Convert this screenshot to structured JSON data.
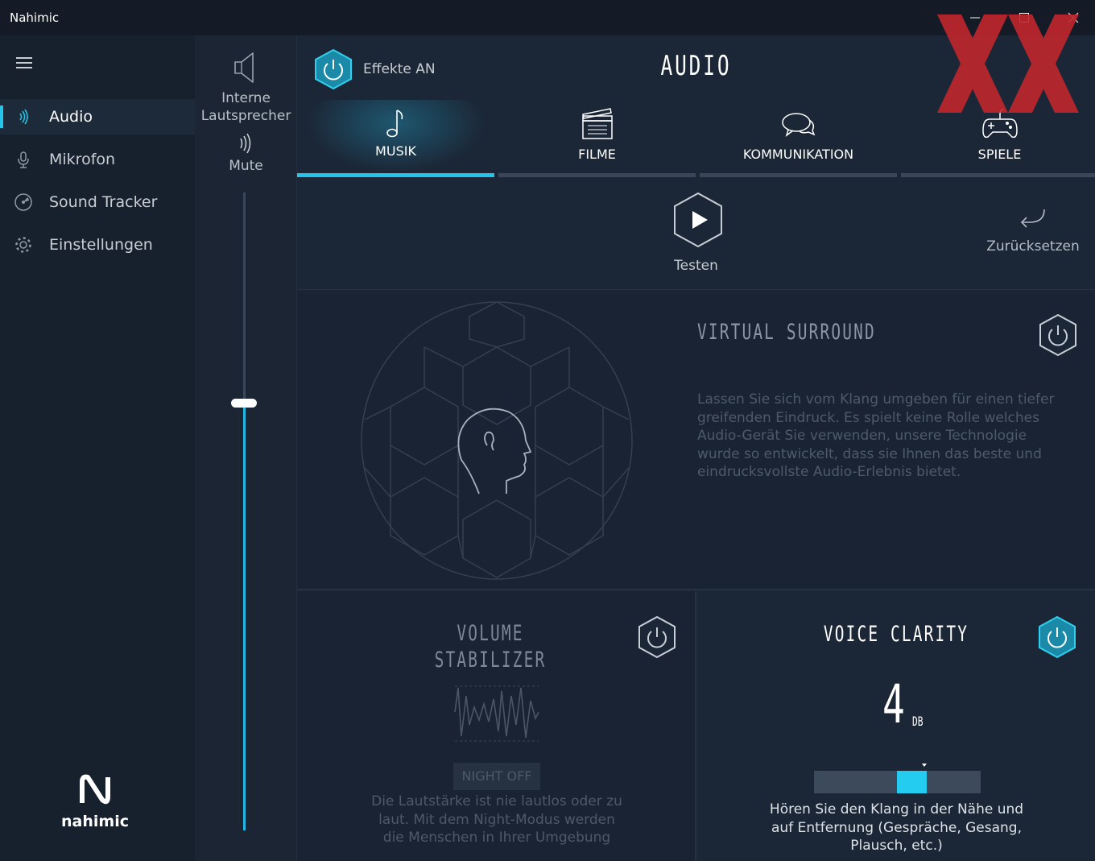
{
  "window": {
    "title": "Nahimic"
  },
  "sidebar": {
    "items": [
      {
        "label": "Audio",
        "icon": "audio-wave-icon",
        "active": true
      },
      {
        "label": "Mikrofon",
        "icon": "microphone-icon",
        "active": false
      },
      {
        "label": "Sound Tracker",
        "icon": "radar-icon",
        "active": false
      },
      {
        "label": "Einstellungen",
        "icon": "gear-icon",
        "active": false
      }
    ],
    "logo_text": "nahimic"
  },
  "device": {
    "name": "Interne Lautsprecher",
    "mute_label": "Mute",
    "volume_fraction": 0.64
  },
  "header": {
    "effects_label": "Effekte AN",
    "title": "AUDIO",
    "tabs": [
      {
        "label": "MUSIK",
        "icon": "music-note-icon",
        "active": true
      },
      {
        "label": "FILME",
        "icon": "clapperboard-icon",
        "active": false
      },
      {
        "label": "KOMMUNIKATION",
        "icon": "chat-bubbles-icon",
        "active": false
      },
      {
        "label": "SPIELE",
        "icon": "gamepad-icon",
        "active": false
      }
    ]
  },
  "test": {
    "label": "Testen",
    "reset_label": "Zurücksetzen"
  },
  "surround": {
    "title": "VIRTUAL SURROUND",
    "description": "Lassen Sie sich vom Klang umgeben für einen tiefer greifenden Eindruck. Es spielt keine Rolle welches Audio-Gerät Sie verwenden, unsere Technologie wurde so entwickelt, dass sie Ihnen das beste und eindrucksvollste Audio-Erlebnis bietet.",
    "enabled": false
  },
  "volume_stabilizer": {
    "title_line1": "VOLUME",
    "title_line2": "STABILIZER",
    "night_label": "NIGHT OFF",
    "description": "Die Lautstärke ist nie lautlos oder zu laut. Mit dem Night-Modus werden die Menschen in Ihrer Umgebung",
    "enabled": false
  },
  "voice_clarity": {
    "title": "VOICE CLARITY",
    "value": "4",
    "unit": "DB",
    "description": "Hören Sie den Klang in der Nähe und auf Entfernung (Gespräche, Gesang, Plausch, etc.)",
    "enabled": true
  },
  "colors": {
    "accent": "#24c5e8",
    "background": "#1b2636",
    "sidebar": "#17202d"
  }
}
